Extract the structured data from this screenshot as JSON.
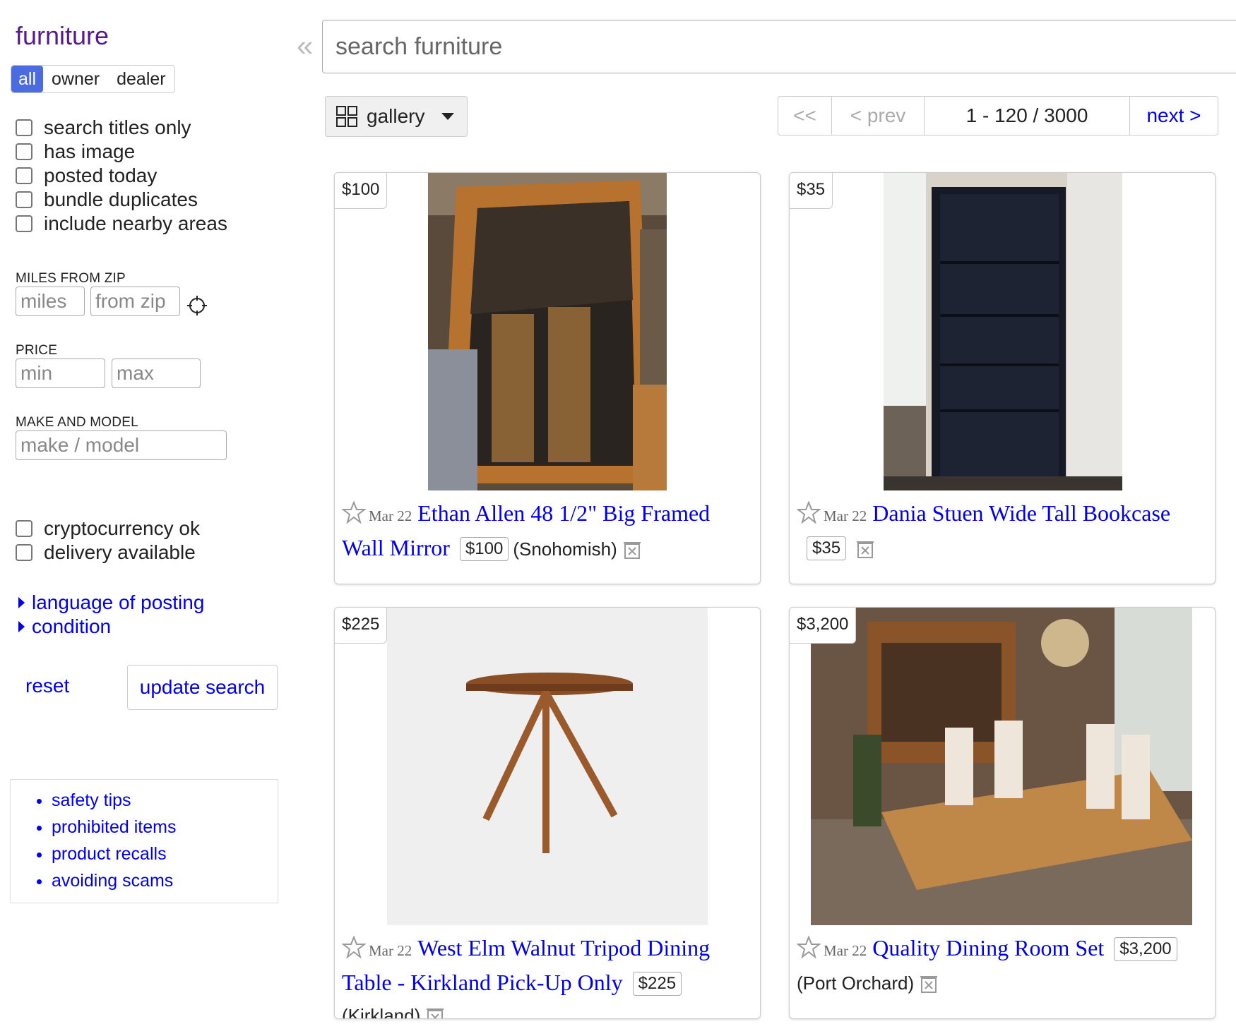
{
  "category_title": "furniture",
  "collapse_glyph": "«",
  "seller_filter": {
    "all": "all",
    "owner": "owner",
    "dealer": "dealer",
    "selected": "all"
  },
  "checkboxes_top": [
    {
      "label": "search titles only"
    },
    {
      "label": "has image"
    },
    {
      "label": "posted today"
    },
    {
      "label": "bundle duplicates"
    },
    {
      "label": "include nearby areas"
    }
  ],
  "miles_from_zip": {
    "heading": "MILES FROM ZIP",
    "miles_placeholder": "miles",
    "zip_placeholder": "from zip"
  },
  "price": {
    "heading": "PRICE",
    "min_placeholder": "min",
    "max_placeholder": "max"
  },
  "make_model": {
    "heading": "MAKE AND MODEL",
    "placeholder": "make / model"
  },
  "checkboxes_bottom": [
    {
      "label": "cryptocurrency ok"
    },
    {
      "label": "delivery available"
    }
  ],
  "expanders": [
    "language of posting",
    "condition"
  ],
  "reset_label": "reset",
  "update_label": "update search",
  "tips": [
    "safety tips",
    "prohibited items",
    "product recalls",
    "avoiding scams"
  ],
  "search": {
    "placeholder": "search furniture"
  },
  "view": {
    "label": "gallery"
  },
  "pager": {
    "first": "<<",
    "prev": "< prev",
    "range": "1 - 120 / 3000",
    "next": "next >"
  },
  "listings": [
    {
      "price": "$100",
      "date": "Mar 22",
      "title": "Ethan Allen 48 1/2\" Big Framed Wall Mirror",
      "location": "(Snohomish)"
    },
    {
      "price": "$35",
      "date": "Mar 22",
      "title": "Dania Stuen Wide Tall Bookcase",
      "location": ""
    },
    {
      "price": "$225",
      "date": "Mar 22",
      "title": "West Elm Walnut Tripod Dining Table - Kirkland Pick-Up Only",
      "location": "(Kirkland)"
    },
    {
      "price": "$3,200",
      "date": "Mar 22",
      "title": "Quality Dining Room Set",
      "location": "(Port Orchard)"
    }
  ],
  "colors": {
    "link": "#0000ee",
    "category": "#551a8b",
    "toggle_active": "#4b6be0"
  }
}
